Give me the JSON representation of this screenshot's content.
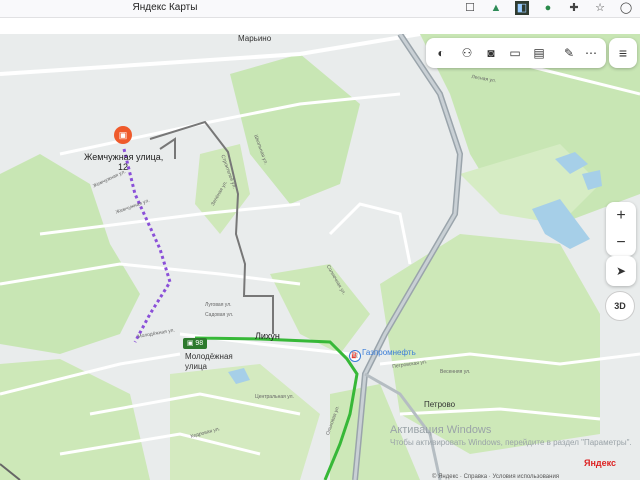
{
  "browser": {
    "tab_title": "Яндекс Карты",
    "icons": [
      "bookmark-icon",
      "extension-green-icon",
      "extension-dark-icon",
      "extension-search-icon",
      "puzzle-icon",
      "favorite-icon",
      "profile-icon"
    ]
  },
  "map": {
    "places": {
      "marvino": "Марьино",
      "destination_line1": "Жемчужная улица,",
      "destination_line2": "12",
      "lihun": "Лихун",
      "stop_line1": "Молодёжная",
      "stop_line2": "улица",
      "gazprom": "Газпромнефть",
      "petrovo": "Петрово"
    },
    "streets": {
      "s1": "Жемчужная ул.",
      "s2": "Жемчужная ул.",
      "s3": "Молодёжная ул.",
      "s4": "Луговая ул.",
      "s5": "Садовая ул.",
      "s6": "Школьная ул.",
      "s7": "Петровская ул.",
      "s8": "Центральная ул.",
      "s9": "Лесная ул.",
      "s10": "Кедровая ул.",
      "s11": "Зелёная ул.",
      "s12": "Солнечная ул.",
      "s13": "Строителей ул.",
      "s14": "Весенняя ул.",
      "s15": "Ольховая ул."
    },
    "bus_number": "98"
  },
  "controls": {
    "zoom_in": "+",
    "zoom_out": "−",
    "mode_3d": "3D"
  },
  "activation": {
    "title": "Активация Windows",
    "text": "Чтобы активировать Windows, перейдите в раздел \"Параметры\"."
  },
  "footer": {
    "logo": "Яндекс",
    "terms": "© Яндекс · Справка · Условия использования"
  }
}
